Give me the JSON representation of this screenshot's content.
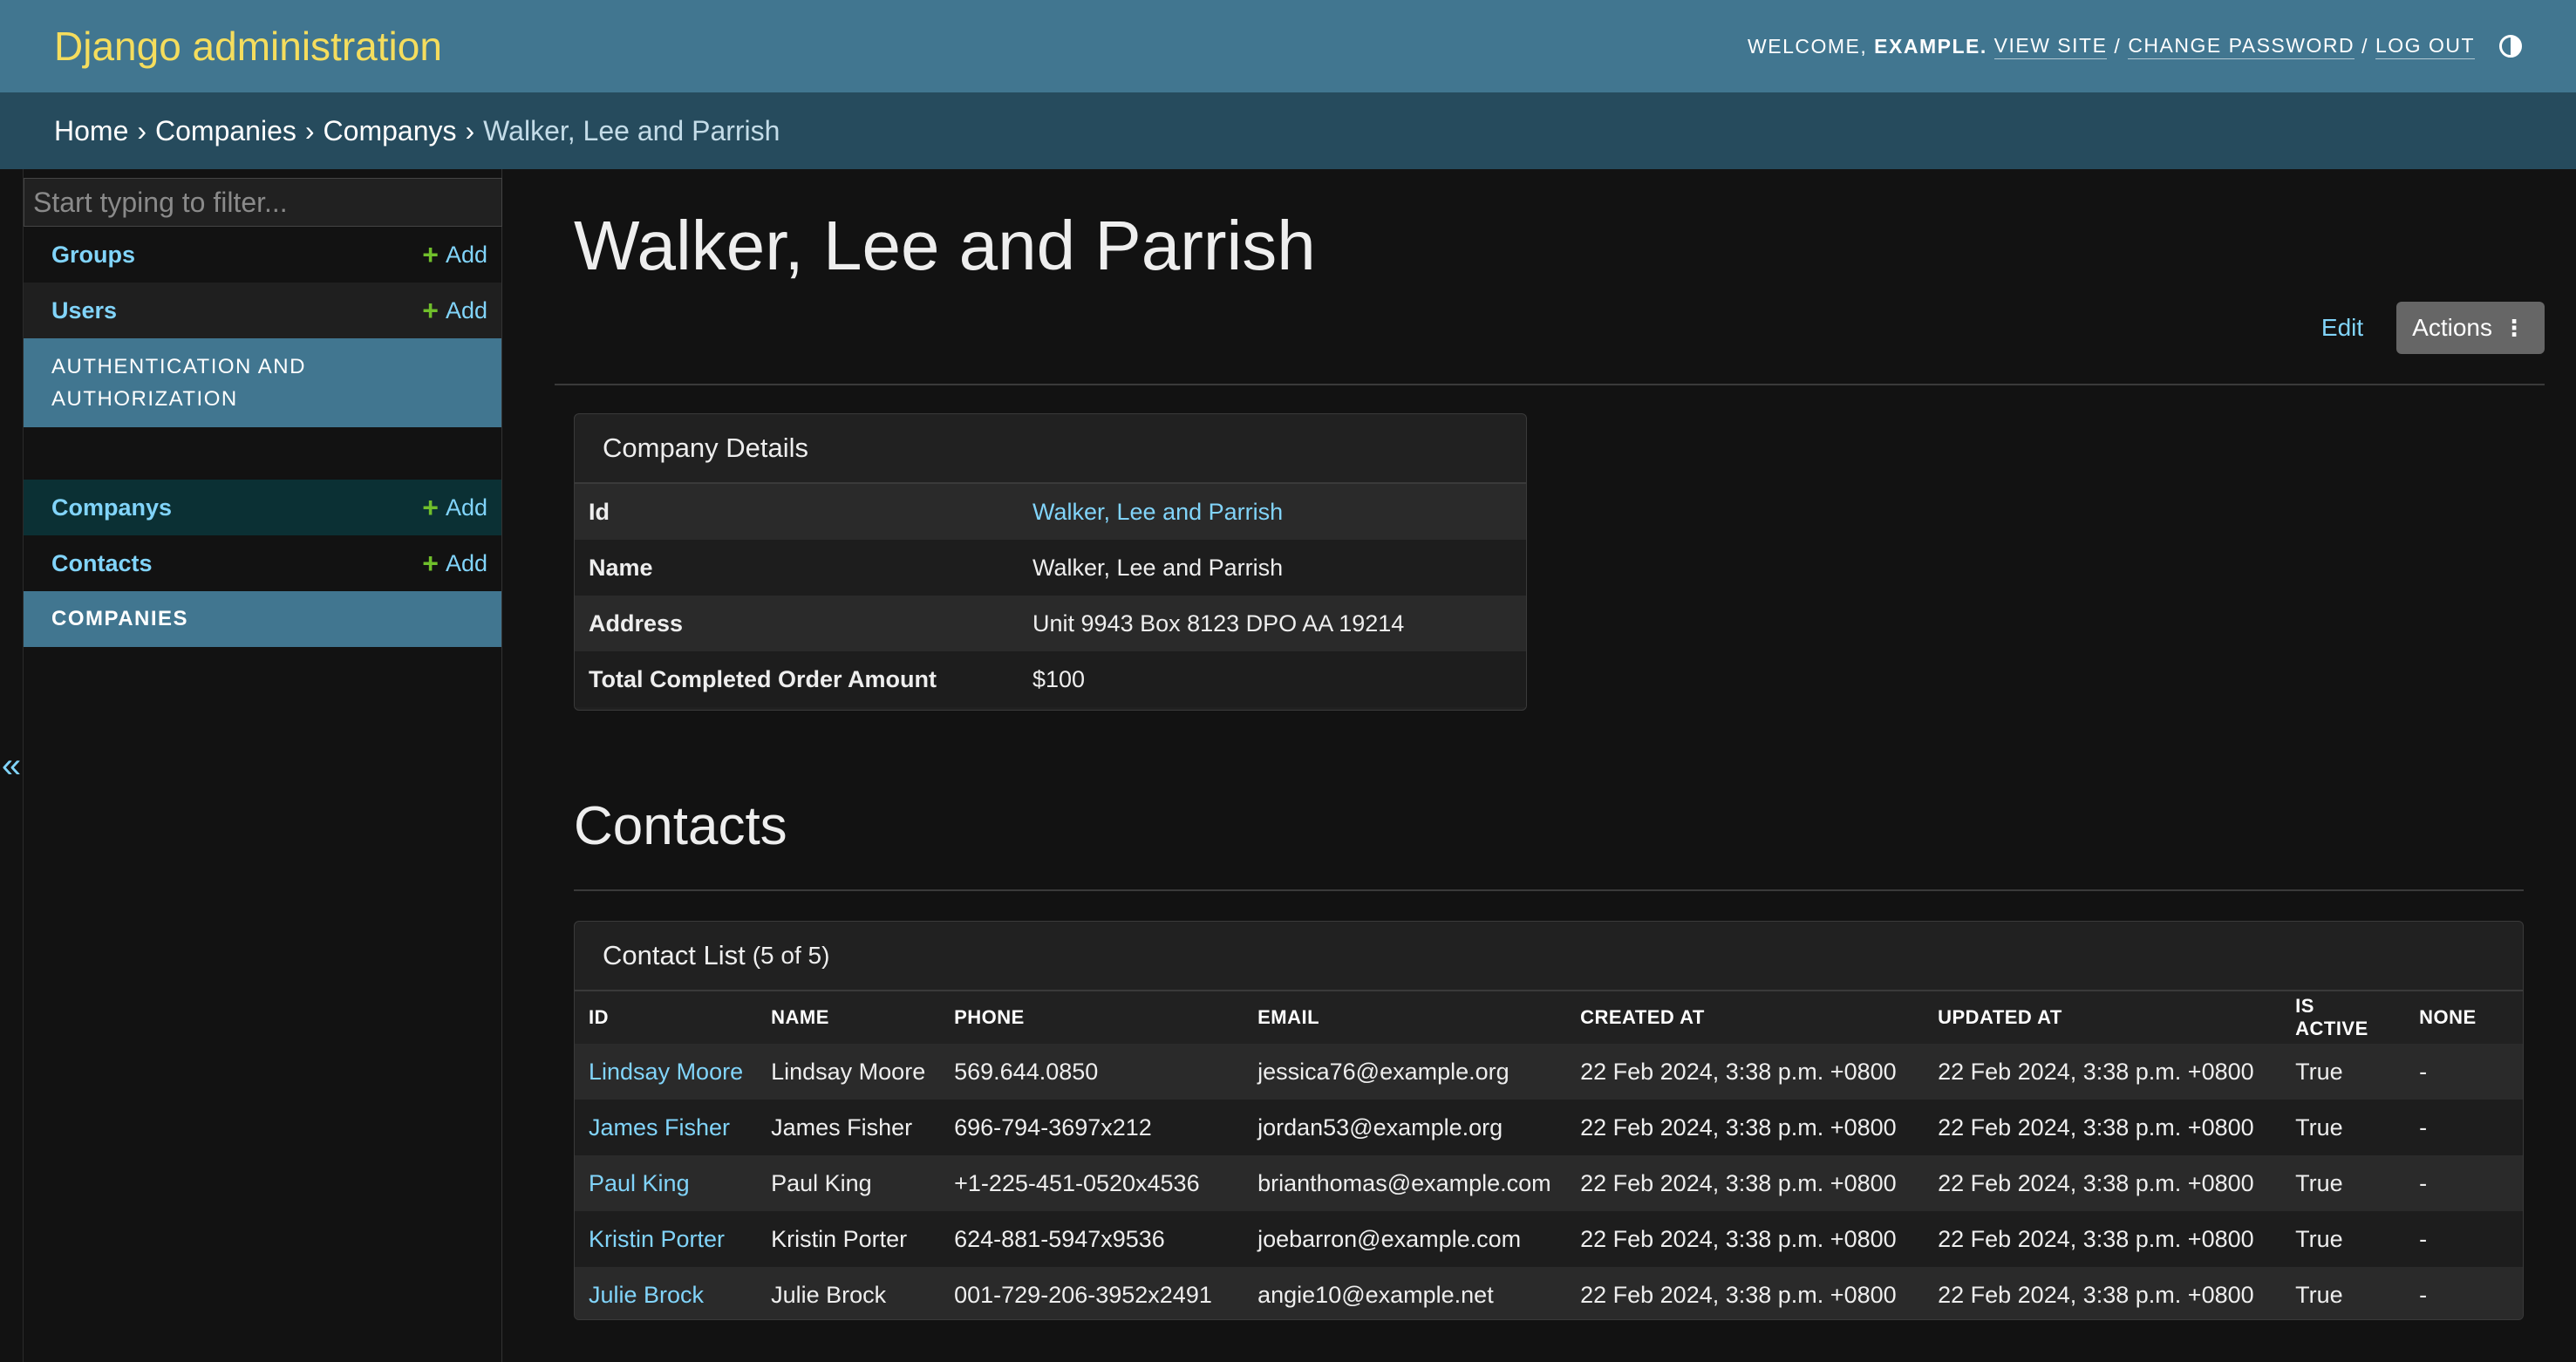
{
  "header": {
    "branding": "Django administration",
    "welcome": "WELCOME,",
    "username": "EXAMPLE.",
    "view_site": "VIEW SITE",
    "change_password": "CHANGE PASSWORD",
    "log_out": "LOG OUT",
    "separator": "/"
  },
  "breadcrumbs": {
    "home": "Home",
    "app": "Companies",
    "model": "Companys",
    "current": "Walker, Lee and Parrish",
    "sep": "›"
  },
  "sidebar": {
    "filter_placeholder": "Start typing to filter...",
    "toggle_glyph": "«",
    "add_label": "Add",
    "plus_glyph": "+",
    "apps": [
      {
        "caption": "AUTHENTICATION AND AUTHORIZATION",
        "models": [
          {
            "name": "Groups"
          },
          {
            "name": "Users"
          }
        ]
      },
      {
        "caption": "COMPANIES",
        "models": [
          {
            "name": "Companys"
          },
          {
            "name": "Contacts"
          }
        ]
      }
    ]
  },
  "main": {
    "title": "Walker, Lee and Parrish",
    "edit_label": "Edit",
    "actions_label": "Actions",
    "actions_glyph": "⋮"
  },
  "details": {
    "header": "Company Details",
    "rows": [
      {
        "label": "Id",
        "value": "Walker, Lee and Parrish"
      },
      {
        "label": "Name",
        "value": "Walker, Lee and Parrish"
      },
      {
        "label": "Address",
        "value": "Unit 9943 Box 8123 DPO AA 19214"
      },
      {
        "label": "Total Completed Order Amount",
        "value": "$100"
      }
    ]
  },
  "contacts": {
    "section_title": "Contacts",
    "panel_title": "Contact List",
    "count": "(5 of 5)",
    "columns": [
      "ID",
      "NAME",
      "PHONE",
      "EMAIL",
      "CREATED AT",
      "UPDATED AT",
      "IS ACTIVE",
      "NONE"
    ],
    "rows": [
      [
        "Lindsay Moore",
        "Lindsay Moore",
        "569.644.0850",
        "jessica76@example.org",
        "22 Feb 2024, 3:38 p.m. +0800",
        "22 Feb 2024, 3:38 p.m. +0800",
        "True",
        "-"
      ],
      [
        "James Fisher",
        "James Fisher",
        "696-794-3697x212",
        "jordan53@example.org",
        "22 Feb 2024, 3:38 p.m. +0800",
        "22 Feb 2024, 3:38 p.m. +0800",
        "True",
        "-"
      ],
      [
        "Paul King",
        "Paul King",
        "+1-225-451-0520x4536",
        "brianthomas@example.com",
        "22 Feb 2024, 3:38 p.m. +0800",
        "22 Feb 2024, 3:38 p.m. +0800",
        "True",
        "-"
      ],
      [
        "Kristin Porter",
        "Kristin Porter",
        "624-881-5947x9536",
        "joebarron@example.com",
        "22 Feb 2024, 3:38 p.m. +0800",
        "22 Feb 2024, 3:38 p.m. +0800",
        "True",
        "-"
      ],
      [
        "Julie Brock",
        "Julie Brock",
        "001-729-206-3952x2491",
        "angie10@example.net",
        "22 Feb 2024, 3:38 p.m. +0800",
        "22 Feb 2024, 3:38 p.m. +0800",
        "True",
        "-"
      ]
    ]
  },
  "colors": {
    "header_bg": "#417690",
    "breadcrumb_bg": "#264b5d",
    "branding": "#f5dd5d",
    "link": "#81d4fa",
    "add_plus": "#70bf2b",
    "page_bg": "#121212"
  },
  "icons": {
    "theme_toggle": "half-circle-icon",
    "add": "plus-icon",
    "actions": "vertical-dots-icon",
    "collapse_sidebar": "double-chevron-left-icon"
  }
}
